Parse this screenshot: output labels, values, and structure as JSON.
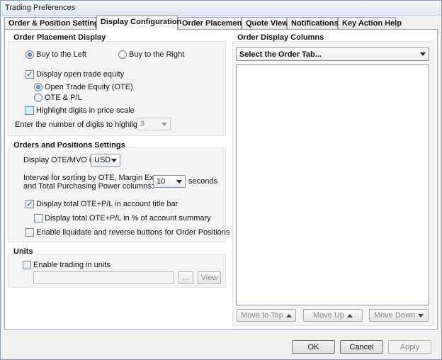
{
  "window": {
    "title": "Trading Preferences"
  },
  "tabs": [
    {
      "label": "Order & Position Settings"
    },
    {
      "label": "Display Configuration"
    },
    {
      "label": "Order Placement"
    },
    {
      "label": "Quote View"
    },
    {
      "label": "Notifications"
    },
    {
      "label": "Key Action Help"
    }
  ],
  "order_placement_display": {
    "title": "Order Placement Display",
    "buy_left": "Buy to the Left",
    "buy_right": "Buy to the Right",
    "selected_side": "Buy to the Left",
    "display_ote": "Display open trade equity",
    "display_ote_checked": true,
    "ote_option": "Open Trade Equity (OTE)",
    "otepl_option": "OTE & P/L",
    "selected_equity": "Open Trade Equity (OTE)",
    "highlight_digits": "Highlight digits in price scale",
    "highlight_digits_checked": false,
    "digits_label": "Enter the number of digits to highlight:",
    "digits_value": "3"
  },
  "orders_positions": {
    "title": "Orders and Positions Settings",
    "display_ote_mvo_label": "Display OTE/MVO in",
    "currency_value": "USD",
    "interval_label_line1": "Interval for sorting by OTE, Margin Excess",
    "interval_label_line2": "and Total Purchasing Power columns:",
    "interval_value": "10",
    "seconds_label": "seconds",
    "total_ote_title": "Display total OTE+P/L in account title bar",
    "total_ote_title_checked": true,
    "total_ote_pct": "Display total OTE+P/L in % of account summary",
    "total_ote_pct_checked": false,
    "liquidate": "Enable liquidate and reverse buttons for Order Positions",
    "liquidate_checked": false
  },
  "units": {
    "title": "Units",
    "enable_trading": "Enable trading in units",
    "enable_trading_checked": false,
    "units_value": "",
    "browse_label": "...",
    "view_label": "View"
  },
  "order_display_columns": {
    "title": "Order Display Columns",
    "tab_select": "Select the Order Tab...",
    "move_to_top": "Move to Top",
    "move_up": "Move Up",
    "move_down": "Move Down"
  },
  "dialog_buttons": {
    "ok": "OK",
    "cancel": "Cancel",
    "apply": "Apply"
  }
}
